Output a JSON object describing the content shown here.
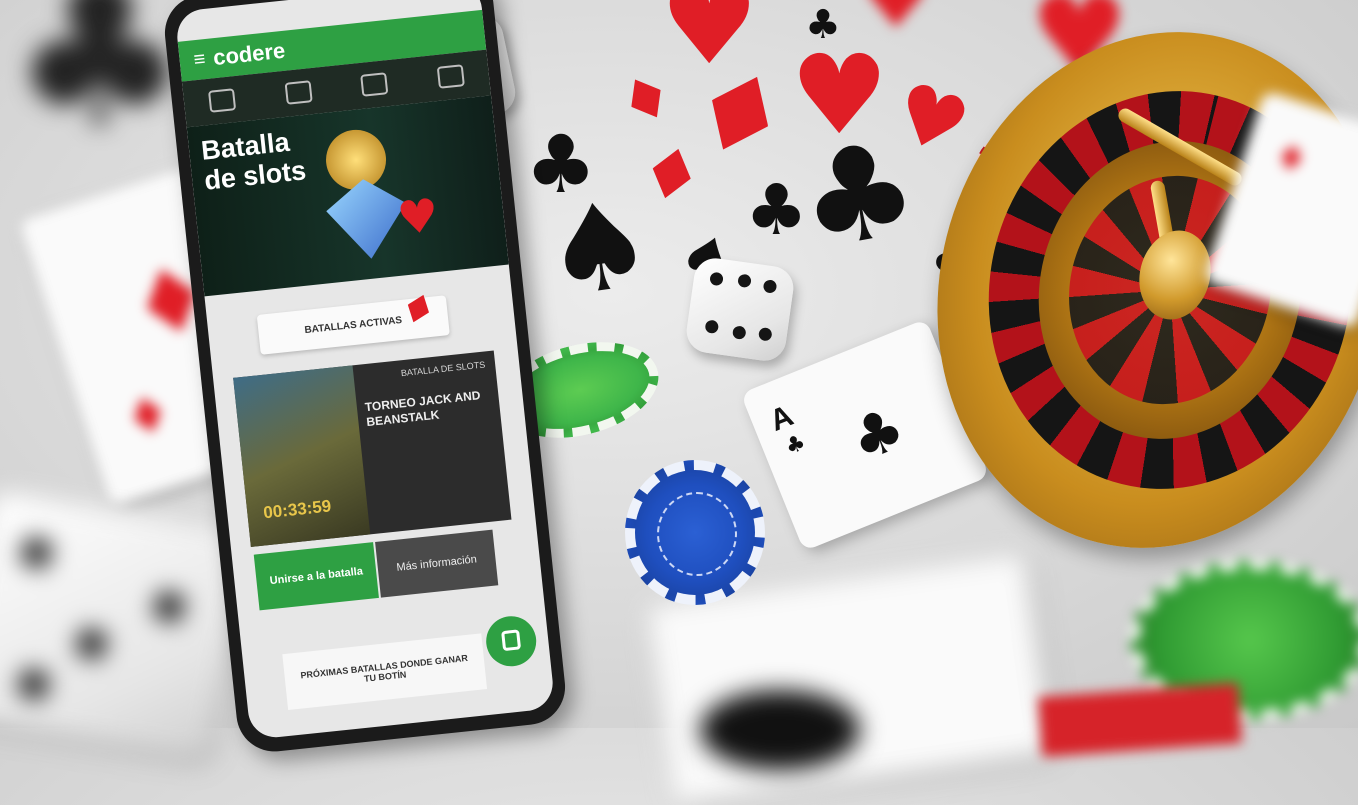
{
  "scene": {
    "description_tag": "casino-promo-collage"
  },
  "phone": {
    "brand": "codere",
    "banner_title_line1": "Batalla",
    "banner_title_line2": "de slots",
    "banner_sub": "",
    "active_tab_label": "BATALLAS ACTIVAS",
    "card_tag": "BATALLA DE SLOTS",
    "card_title": "TORNEO JACK AND BEANSTALK",
    "timer": "00:33:59",
    "join_button": "Unirse a la batalla",
    "info_button": "Más información",
    "next_bar": "PRÓXIMAS BATALLAS DONDE GANAR TU BOTÍN"
  },
  "colors": {
    "brand_green": "#2ea043",
    "chip_green": "#3fb64a",
    "chip_blue": "#1f4fbf",
    "chip_red": "#c61a24",
    "suit_red": "#e01e26",
    "suit_black": "#111111",
    "gold": "#d9a431"
  },
  "icons": {
    "playing_card_rank": "A",
    "club": "♣",
    "spade": "♠",
    "heart": "♥",
    "diamond": "♦"
  }
}
